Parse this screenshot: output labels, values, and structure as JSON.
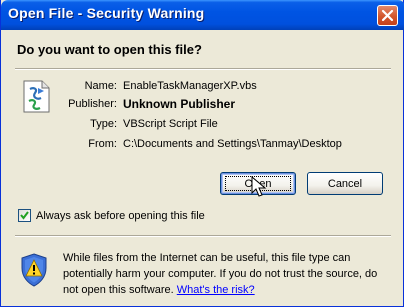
{
  "window": {
    "title": "Open File - Security Warning"
  },
  "dialog": {
    "question": "Do you want to open this file?",
    "fields": [
      {
        "label": "Name:",
        "value": "EnableTaskManagerXP.vbs",
        "bold": false
      },
      {
        "label": "Publisher:",
        "value": "Unknown Publisher",
        "bold": true
      },
      {
        "label": "Type:",
        "value": "VBScript Script File",
        "bold": false
      },
      {
        "label": "From:",
        "value": "C:\\Documents and Settings\\Tanmay\\Desktop",
        "bold": false
      }
    ],
    "buttons": {
      "open_label": "Open",
      "cancel_label": "Cancel"
    },
    "checkbox": {
      "label": "Always ask before opening this file",
      "checked": true
    },
    "warning": {
      "text": "While files from the Internet can be useful, this file type can potentially harm your computer. If you do not trust the source, do not open this software.",
      "link_text": "What's the risk?"
    }
  },
  "icons": {
    "file": "vbs-script-file-icon",
    "shield": "security-shield-icon",
    "close": "close-icon",
    "cursor": "mouse-pointer-icon"
  },
  "colors": {
    "titlebar": "#0054e3",
    "close_button": "#d2562c",
    "dialog_background": "#ece9d8",
    "link": "#0000ff"
  }
}
